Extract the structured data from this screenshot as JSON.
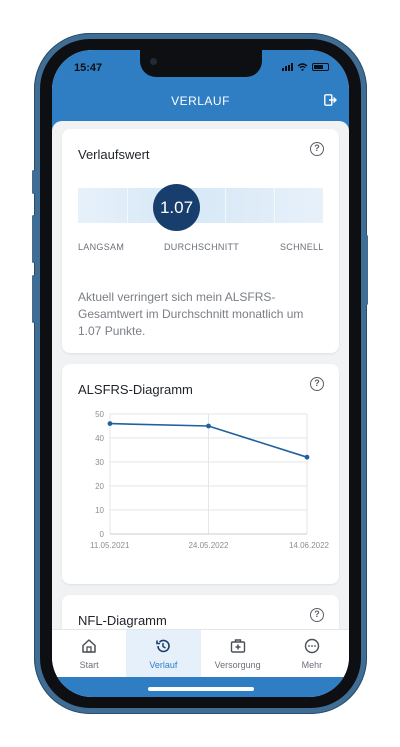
{
  "status_bar": {
    "time": "15:47"
  },
  "header": {
    "title": "VERLAUF",
    "logout_icon": "logout-icon"
  },
  "rate_card": {
    "title": "Verlaufswert",
    "value": "1.07",
    "scale_labels": [
      "LANGSAM",
      "DURCHSCHNITT",
      "SCHNELL"
    ],
    "description": "Aktuell verringert sich mein ALSFRS-Gesamtwert im Durchschnitt monatlich um 1.07 Punkte."
  },
  "alsfrs_card": {
    "title": "ALSFRS-Diagramm"
  },
  "nfl_card": {
    "title": "NFL-Diagramm"
  },
  "help_symbol": "?",
  "chart_data": {
    "type": "line",
    "x": [
      "11.05.2021",
      "24.05.2022",
      "14.06.2022"
    ],
    "y": [
      46,
      45,
      32
    ],
    "yticks": [
      0,
      10,
      20,
      30,
      40,
      50
    ],
    "ylim": [
      0,
      50
    ],
    "grid": true,
    "color": "#2060a0"
  },
  "nav": {
    "items": [
      {
        "label": "Start",
        "icon": "home-icon"
      },
      {
        "label": "Verlauf",
        "icon": "history-icon",
        "active": true
      },
      {
        "label": "Versorgung",
        "icon": "medical-kit-icon"
      },
      {
        "label": "Mehr",
        "icon": "more-icon"
      }
    ]
  },
  "colors": {
    "primary": "#2f7ec4",
    "bubble": "#173e6d"
  }
}
